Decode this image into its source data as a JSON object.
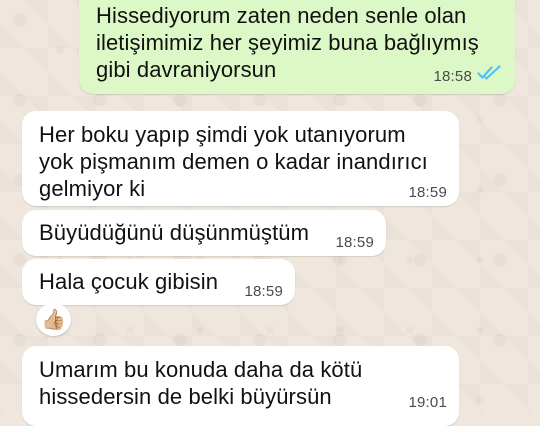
{
  "chat": {
    "messages": [
      {
        "direction": "outgoing",
        "text": "Hissediyorum zaten neden senle olan iletişimimiz her şeyimiz buna bağlıymış gibi davraniyorsun",
        "time": "18:58",
        "status_icon": "double-check-read-icon",
        "status_color": "#4fc3f7"
      },
      {
        "direction": "incoming",
        "text": "Her boku yapıp şimdi yok utanıyorum yok pişmanım demen o kadar inandırıcı gelmiyor ki",
        "time": "18:59"
      },
      {
        "direction": "incoming",
        "text": "Büyüdüğünü düşünmüştüm",
        "time": "18:59"
      },
      {
        "direction": "incoming",
        "text": "Hala çocuk gibisin",
        "time": "18:59",
        "reaction": "👍🏼"
      },
      {
        "direction": "incoming",
        "text": "Umarım bu konuda daha da kötü hissedersin de belki büyürsün",
        "time": "19:01"
      }
    ]
  },
  "colors": {
    "outgoing_bubble": "#dcf8c6",
    "incoming_bubble": "#ffffff",
    "wallpaper": "#efe7dd"
  }
}
